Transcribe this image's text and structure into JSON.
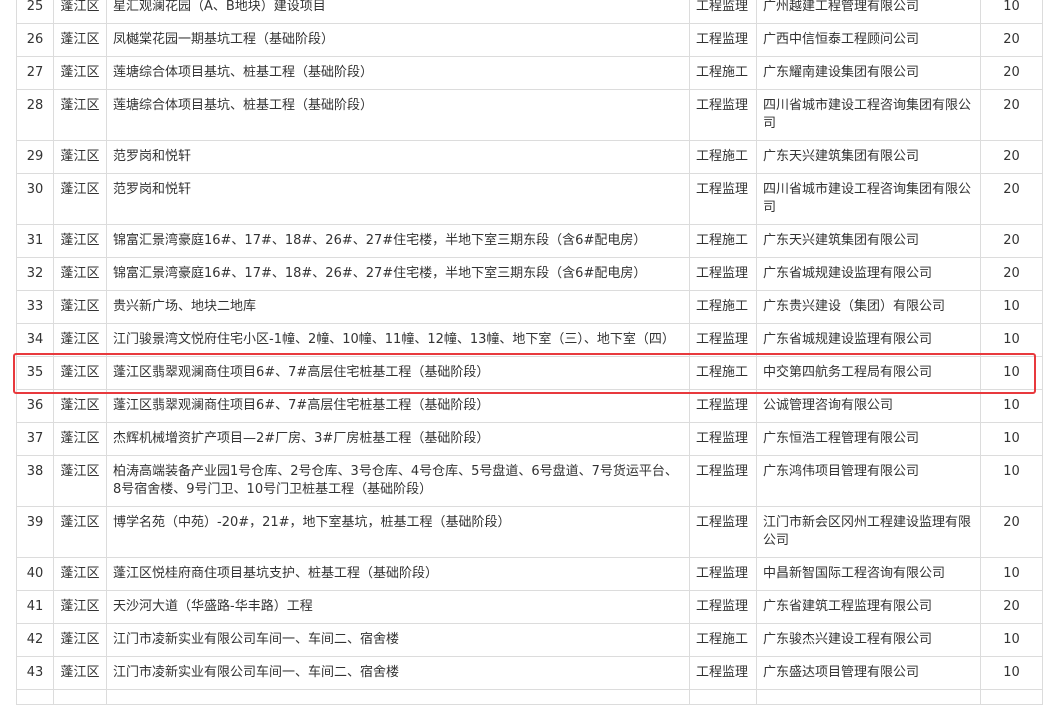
{
  "table": {
    "rows": [
      {
        "no": "25",
        "district": "蓬江区",
        "project": "星汇观澜花园（A、B地块）建设项目",
        "type": "工程监理",
        "company": "广州越建工程管理有限公司",
        "score": "10"
      },
      {
        "no": "26",
        "district": "蓬江区",
        "project": "凤樾棠花园一期基坑工程（基础阶段）",
        "type": "工程监理",
        "company": "广西中信恒泰工程顾问公司",
        "score": "20"
      },
      {
        "no": "27",
        "district": "蓬江区",
        "project": "莲塘综合体项目基坑、桩基工程（基础阶段）",
        "type": "工程施工",
        "company": "广东耀南建设集团有限公司",
        "score": "20"
      },
      {
        "no": "28",
        "district": "蓬江区",
        "project": "莲塘综合体项目基坑、桩基工程（基础阶段）",
        "type": "工程监理",
        "company": "四川省城市建设工程咨询集团有限公司",
        "score": "20"
      },
      {
        "no": "29",
        "district": "蓬江区",
        "project": "范罗岗和悦轩",
        "type": "工程施工",
        "company": "广东天兴建筑集团有限公司",
        "score": "20"
      },
      {
        "no": "30",
        "district": "蓬江区",
        "project": "范罗岗和悦轩",
        "type": "工程监理",
        "company": "四川省城市建设工程咨询集团有限公司",
        "score": "20"
      },
      {
        "no": "31",
        "district": "蓬江区",
        "project": "锦富汇景湾豪庭16#、17#、18#、26#、27#住宅楼，半地下室三期东段（含6#配电房）",
        "type": "工程施工",
        "company": "广东天兴建筑集团有限公司",
        "score": "20"
      },
      {
        "no": "32",
        "district": "蓬江区",
        "project": "锦富汇景湾豪庭16#、17#、18#、26#、27#住宅楼，半地下室三期东段（含6#配电房）",
        "type": "工程监理",
        "company": "广东省城规建设监理有限公司",
        "score": "20"
      },
      {
        "no": "33",
        "district": "蓬江区",
        "project": "贵兴新广场、地块二地库",
        "type": "工程施工",
        "company": "广东贵兴建设（集团）有限公司",
        "score": "10"
      },
      {
        "no": "34",
        "district": "蓬江区",
        "project": "江门骏景湾文悦府住宅小区-1幢、2幢、10幢、11幢、12幢、13幢、地下室（三）、地下室（四）",
        "type": "工程监理",
        "company": "广东省城规建设监理有限公司",
        "score": "10"
      },
      {
        "no": "35",
        "district": "蓬江区",
        "project": "蓬江区翡翠观澜商住项目6#、7#高层住宅桩基工程（基础阶段）",
        "type": "工程施工",
        "company": "中交第四航务工程局有限公司",
        "score": "10"
      },
      {
        "no": "36",
        "district": "蓬江区",
        "project": "蓬江区翡翠观澜商住项目6#、7#高层住宅桩基工程（基础阶段）",
        "type": "工程监理",
        "company": "公诚管理咨询有限公司",
        "score": "10"
      },
      {
        "no": "37",
        "district": "蓬江区",
        "project": "杰辉机械增资扩产项目—2#厂房、3#厂房桩基工程（基础阶段）",
        "type": "工程监理",
        "company": "广东恒浩工程管理有限公司",
        "score": "10"
      },
      {
        "no": "38",
        "district": "蓬江区",
        "project": "柏涛高端装备产业园1号仓库、2号仓库、3号仓库、4号仓库、5号盘道、6号盘道、7号货运平台、8号宿舍楼、9号门卫、10号门卫桩基工程（基础阶段）",
        "type": "工程监理",
        "company": "广东鸿伟项目管理有限公司",
        "score": "10"
      },
      {
        "no": "39",
        "district": "蓬江区",
        "project": "博学名苑（中苑）-20#，21#，地下室基坑，桩基工程（基础阶段）",
        "type": "工程监理",
        "company": "江门市新会区冈州工程建设监理有限公司",
        "score": "20"
      },
      {
        "no": "40",
        "district": "蓬江区",
        "project": "蓬江区悦桂府商住项目基坑支护、桩基工程（基础阶段）",
        "type": "工程监理",
        "company": "中昌新智国际工程咨询有限公司",
        "score": "10"
      },
      {
        "no": "41",
        "district": "蓬江区",
        "project": "天沙河大道（华盛路-华丰路）工程",
        "type": "工程监理",
        "company": "广东省建筑工程监理有限公司",
        "score": "20"
      },
      {
        "no": "42",
        "district": "蓬江区",
        "project": "江门市凌新实业有限公司车间一、车间二、宿舍楼",
        "type": "工程施工",
        "company": "广东骏杰兴建设工程有限公司",
        "score": "10"
      },
      {
        "no": "43",
        "district": "蓬江区",
        "project": "江门市凌新实业有限公司车间一、车间二、宿舍楼",
        "type": "工程监理",
        "company": "广东盛达项目管理有限公司",
        "score": "10"
      },
      {
        "no": "",
        "district": "",
        "project": "",
        "type": "",
        "company": "",
        "score": ""
      }
    ]
  },
  "highlight": {
    "row_no": "35",
    "color": "#e8393d"
  }
}
